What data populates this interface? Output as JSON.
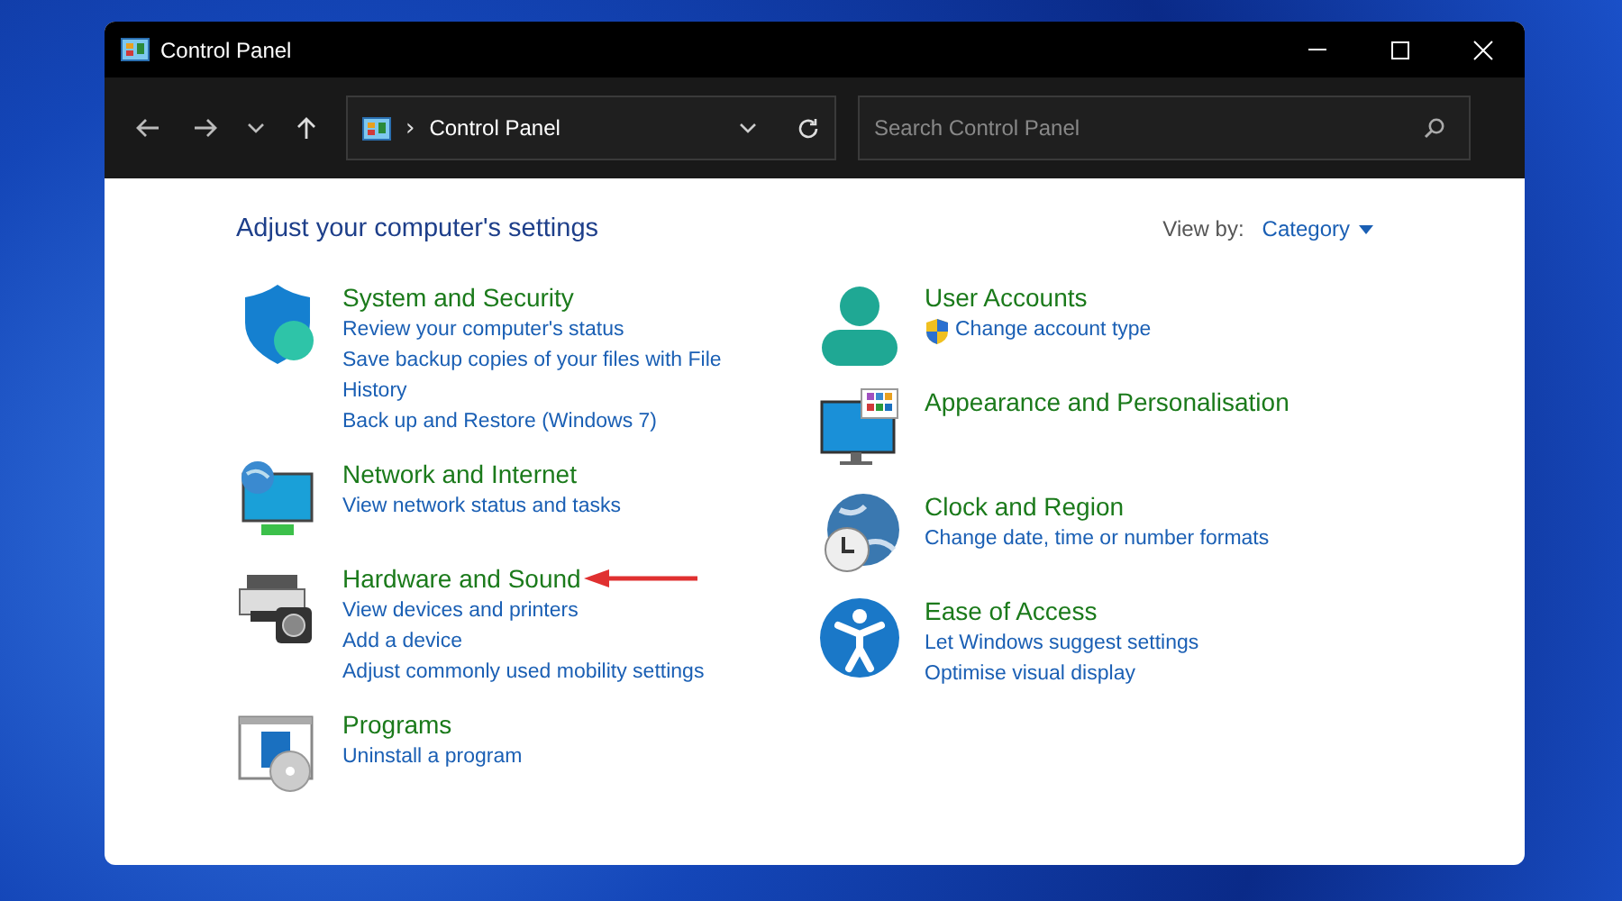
{
  "window": {
    "title": "Control Panel"
  },
  "address_bar": {
    "path": "Control Panel",
    "separator": "›"
  },
  "search": {
    "placeholder": "Search Control Panel"
  },
  "heading": "Adjust your computer's settings",
  "view_by": {
    "label": "View by:",
    "value": "Category"
  },
  "columns": [
    [
      {
        "title": "System and Security",
        "highlighted": false,
        "links": [
          {
            "text": "Review your computer's status",
            "shield": false
          },
          {
            "text": "Save backup copies of your files with File History",
            "shield": false
          },
          {
            "text": "Back up and Restore (Windows 7)",
            "shield": false
          }
        ]
      },
      {
        "title": "Network and Internet",
        "highlighted": false,
        "links": [
          {
            "text": "View network status and tasks",
            "shield": false
          }
        ]
      },
      {
        "title": "Hardware and Sound",
        "highlighted": true,
        "links": [
          {
            "text": "View devices and printers",
            "shield": false
          },
          {
            "text": "Add a device",
            "shield": false
          },
          {
            "text": "Adjust commonly used mobility settings",
            "shield": false
          }
        ]
      },
      {
        "title": "Programs",
        "highlighted": false,
        "links": [
          {
            "text": "Uninstall a program",
            "shield": false
          }
        ]
      }
    ],
    [
      {
        "title": "User Accounts",
        "highlighted": false,
        "links": [
          {
            "text": "Change account type",
            "shield": true
          }
        ]
      },
      {
        "title": "Appearance and Personalisation",
        "highlighted": false
      },
      {
        "title": "Clock and Region",
        "highlighted": false,
        "links": [
          {
            "text": "Change date, time or number formats",
            "shield": false
          }
        ]
      },
      {
        "title": "Ease of Access",
        "highlighted": false,
        "links": [
          {
            "text": "Let Windows suggest settings",
            "shield": false
          },
          {
            "text": "Optimise visual display",
            "shield": false
          }
        ]
      }
    ]
  ]
}
